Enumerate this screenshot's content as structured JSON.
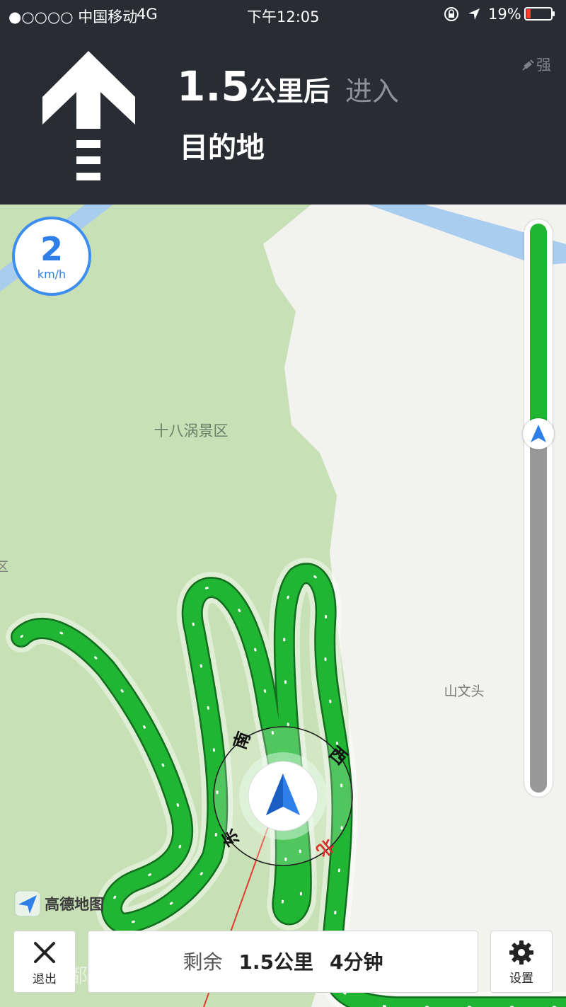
{
  "status_bar": {
    "carrier": "●○○○○ 中国移动",
    "network": "4G",
    "time": "下午12:05",
    "battery_percent": "19%",
    "battery_level": 0.19
  },
  "guidance": {
    "distance_value": "1.5",
    "distance_unit": "公里后",
    "action": "进入",
    "destination": "目的地",
    "gps_signal": "强"
  },
  "speed": {
    "value": "2",
    "unit": "km/h"
  },
  "map": {
    "labels": {
      "scenic_area": "十八涡景区",
      "village": "山文头",
      "edge_label": "区"
    },
    "compass": {
      "south": "南",
      "west": "西",
      "east": "东",
      "north": "北"
    },
    "brand": "高德地图"
  },
  "progress": {
    "completed_fraction": 0.37
  },
  "bottom_bar": {
    "exit_label": "退出",
    "remaining_label": "剩余",
    "remaining_distance": "1.5公里",
    "remaining_time": "4分钟",
    "settings_label": "设置"
  },
  "watermark": "人人都是产品经理",
  "colors": {
    "header_bg": "#292c33",
    "route_green": "#20b633",
    "park_green": "#c5e0b4",
    "river_blue": "#a9cdee",
    "nav_blue": "#2f7fe8",
    "progress_gray": "#999999",
    "battery_red": "#ff3b30"
  },
  "icons": [
    "straight-arrow-icon",
    "gps-satellite-icon",
    "location-arrow-icon",
    "lock-rotation-icon",
    "close-icon",
    "gear-icon",
    "car-arrow-icon"
  ]
}
